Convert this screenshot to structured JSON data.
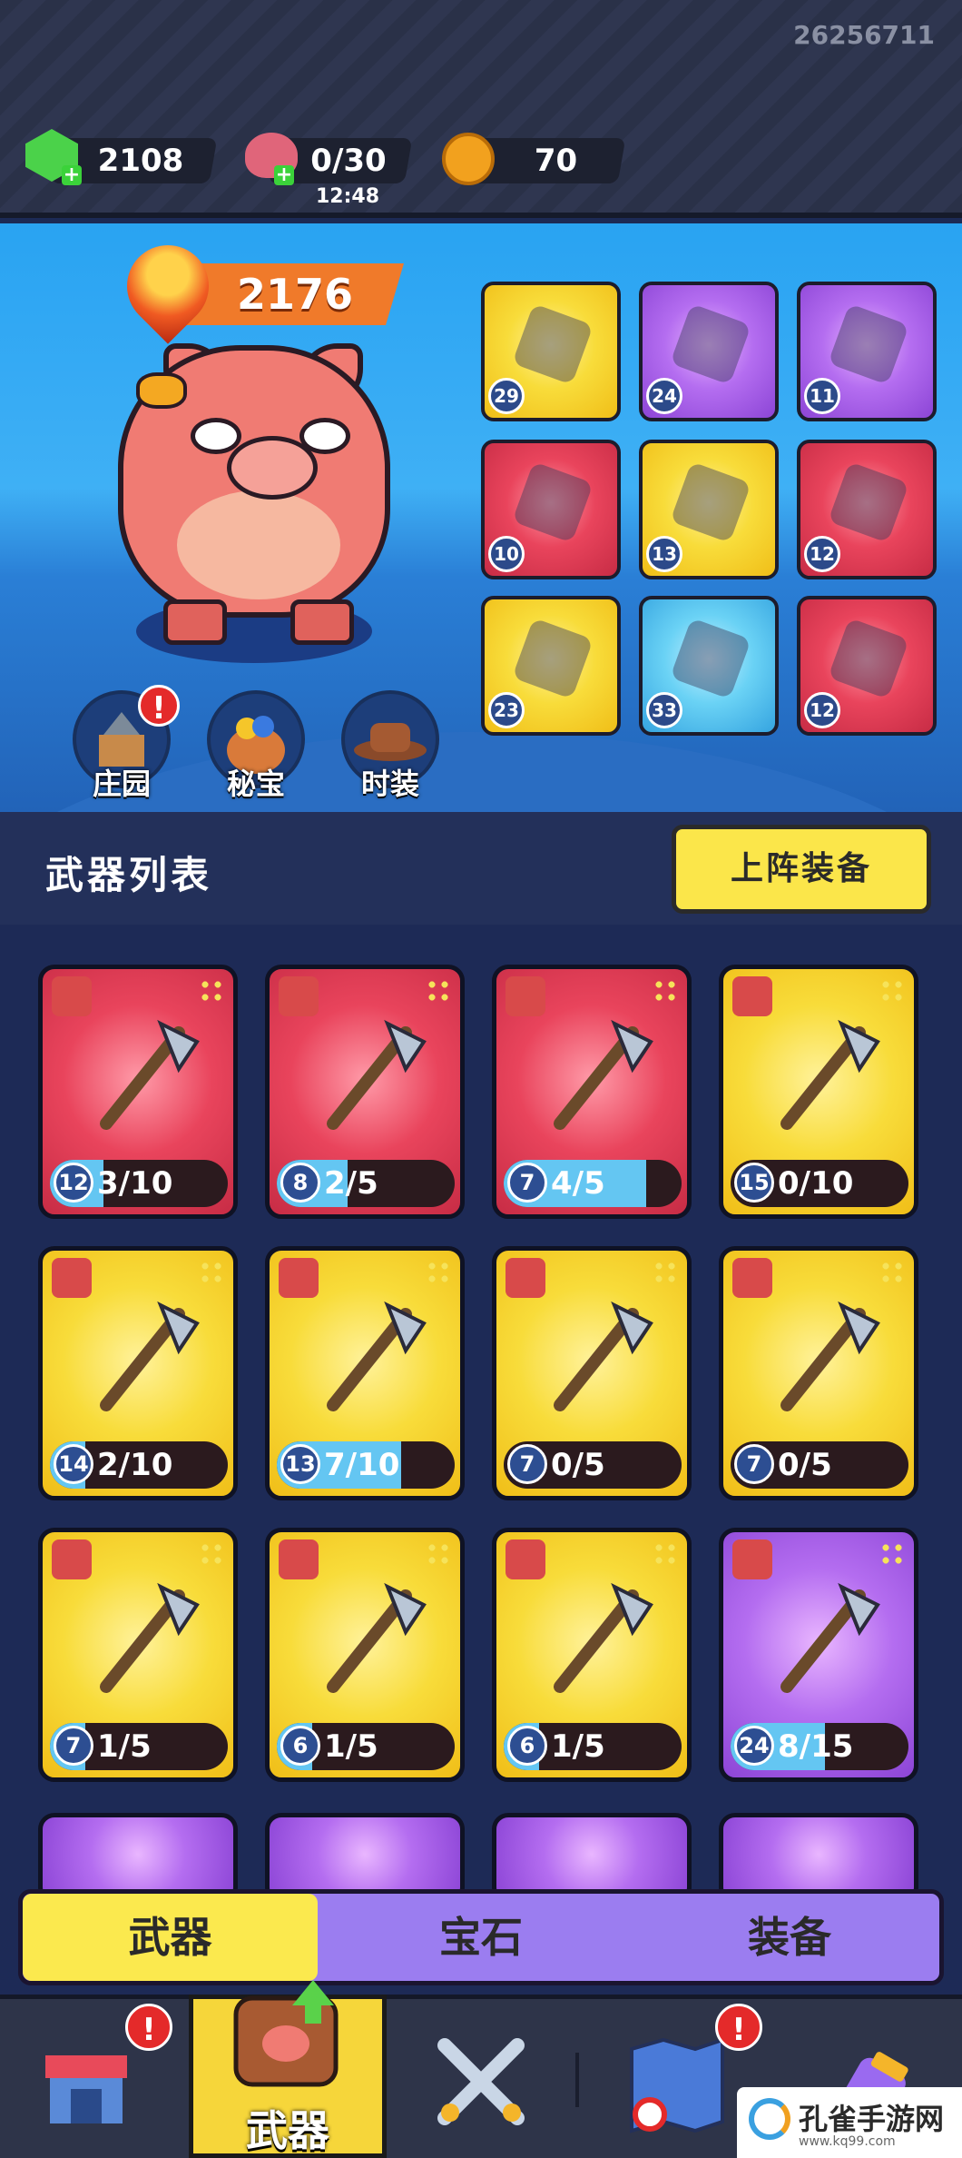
{
  "top": {
    "uid": "26256711",
    "gems": "2108",
    "meat": "0/30",
    "meat_timer": "12:48",
    "coins": "70"
  },
  "hero": {
    "power": "2176",
    "buttons": [
      {
        "label": "庄园"
      },
      {
        "label": "秘宝"
      },
      {
        "label": "时装"
      }
    ]
  },
  "equipped": [
    "29",
    "24",
    "11",
    "10",
    "13",
    "12",
    "23",
    "33",
    "12"
  ],
  "list": {
    "title": "武器列表",
    "equip_button": "上阵装备"
  },
  "weapons": [
    {
      "level": "12",
      "progress": "3/10",
      "fill": 0.3,
      "rarity": "red"
    },
    {
      "level": "8",
      "progress": "2/5",
      "fill": 0.4,
      "rarity": "red"
    },
    {
      "level": "7",
      "progress": "4/5",
      "fill": 0.8,
      "rarity": "red"
    },
    {
      "level": "15",
      "progress": "0/10",
      "fill": 0,
      "rarity": "yellow"
    },
    {
      "level": "14",
      "progress": "2/10",
      "fill": 0.2,
      "rarity": "yellow"
    },
    {
      "level": "13",
      "progress": "7/10",
      "fill": 0.7,
      "rarity": "yellow"
    },
    {
      "level": "7",
      "progress": "0/5",
      "fill": 0,
      "rarity": "yellow"
    },
    {
      "level": "7",
      "progress": "0/5",
      "fill": 0,
      "rarity": "yellow"
    },
    {
      "level": "7",
      "progress": "1/5",
      "fill": 0.2,
      "rarity": "yellow"
    },
    {
      "level": "6",
      "progress": "1/5",
      "fill": 0.2,
      "rarity": "yellow"
    },
    {
      "level": "6",
      "progress": "1/5",
      "fill": 0.2,
      "rarity": "yellow"
    },
    {
      "level": "24",
      "progress": "8/15",
      "fill": 0.53,
      "rarity": "purple"
    }
  ],
  "subtabs": [
    "武器",
    "宝石",
    "装备"
  ],
  "nav": {
    "active_label": "武器"
  },
  "watermark": {
    "title": "孔雀手游网",
    "sub": "www.kq99.com"
  }
}
